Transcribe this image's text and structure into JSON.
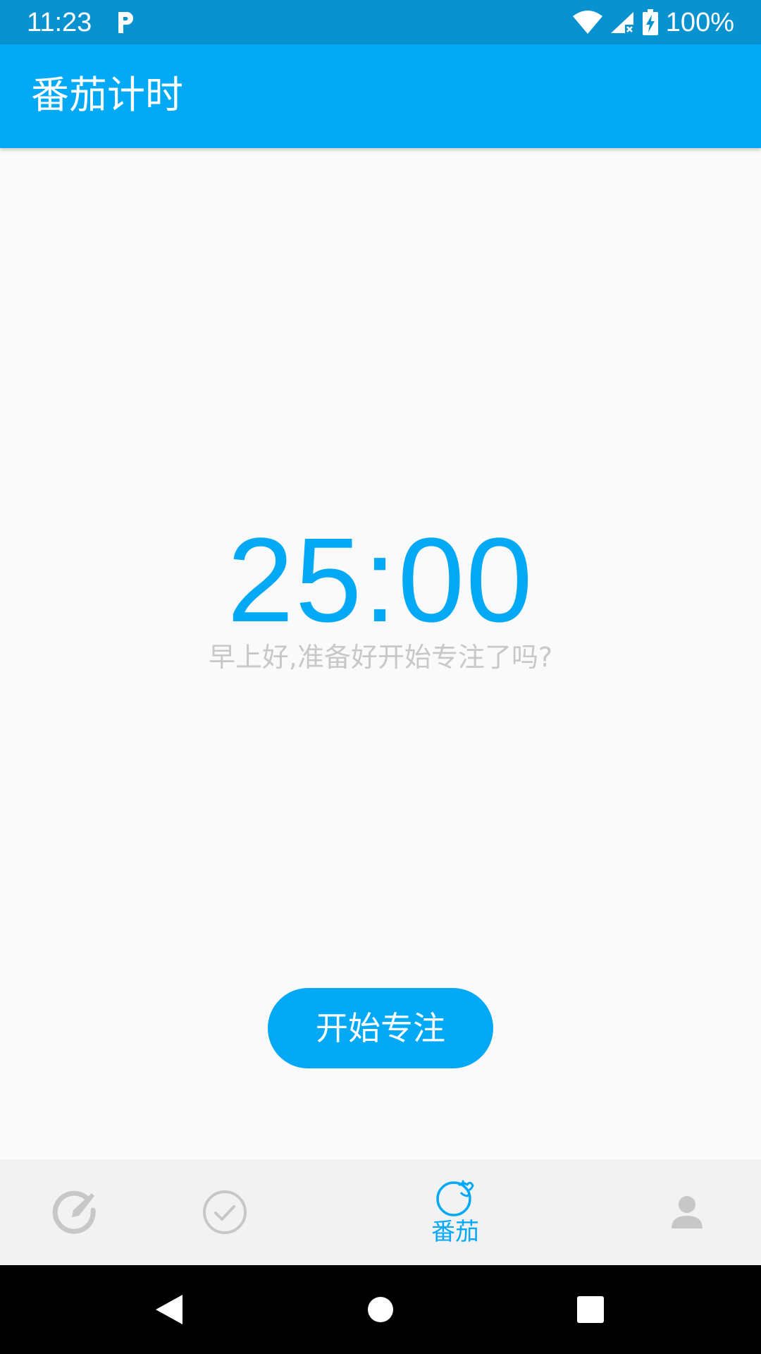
{
  "status_bar": {
    "time": "11:23",
    "battery": "100%",
    "icons": [
      "parking-app-icon",
      "wifi-icon",
      "cell-signal-icon",
      "battery-charging-icon"
    ]
  },
  "app_bar": {
    "title": "番茄计时"
  },
  "timer": {
    "display": "25:00",
    "greeting": "早上好,准备好开始专注了吗?"
  },
  "actions": {
    "start_label": "开始专注"
  },
  "bottom_nav": {
    "items": [
      {
        "icon": "edit-circle-icon",
        "label": "",
        "active": false
      },
      {
        "icon": "check-circle-icon",
        "label": "",
        "active": false
      },
      {
        "icon": "tomato-icon",
        "label": "番茄",
        "active": true
      },
      {
        "icon": "person-icon",
        "label": "",
        "active": false
      }
    ]
  },
  "system_nav": {
    "buttons": [
      "back-icon",
      "home-icon",
      "recents-icon"
    ]
  },
  "colors": {
    "status_bar": "#0892d0",
    "primary": "#03a9f4",
    "background": "#fafafa",
    "bottom_nav": "#f2f2f2",
    "inactive_icon": "#c7c7c7",
    "greeting_text": "#c8c8c8"
  }
}
